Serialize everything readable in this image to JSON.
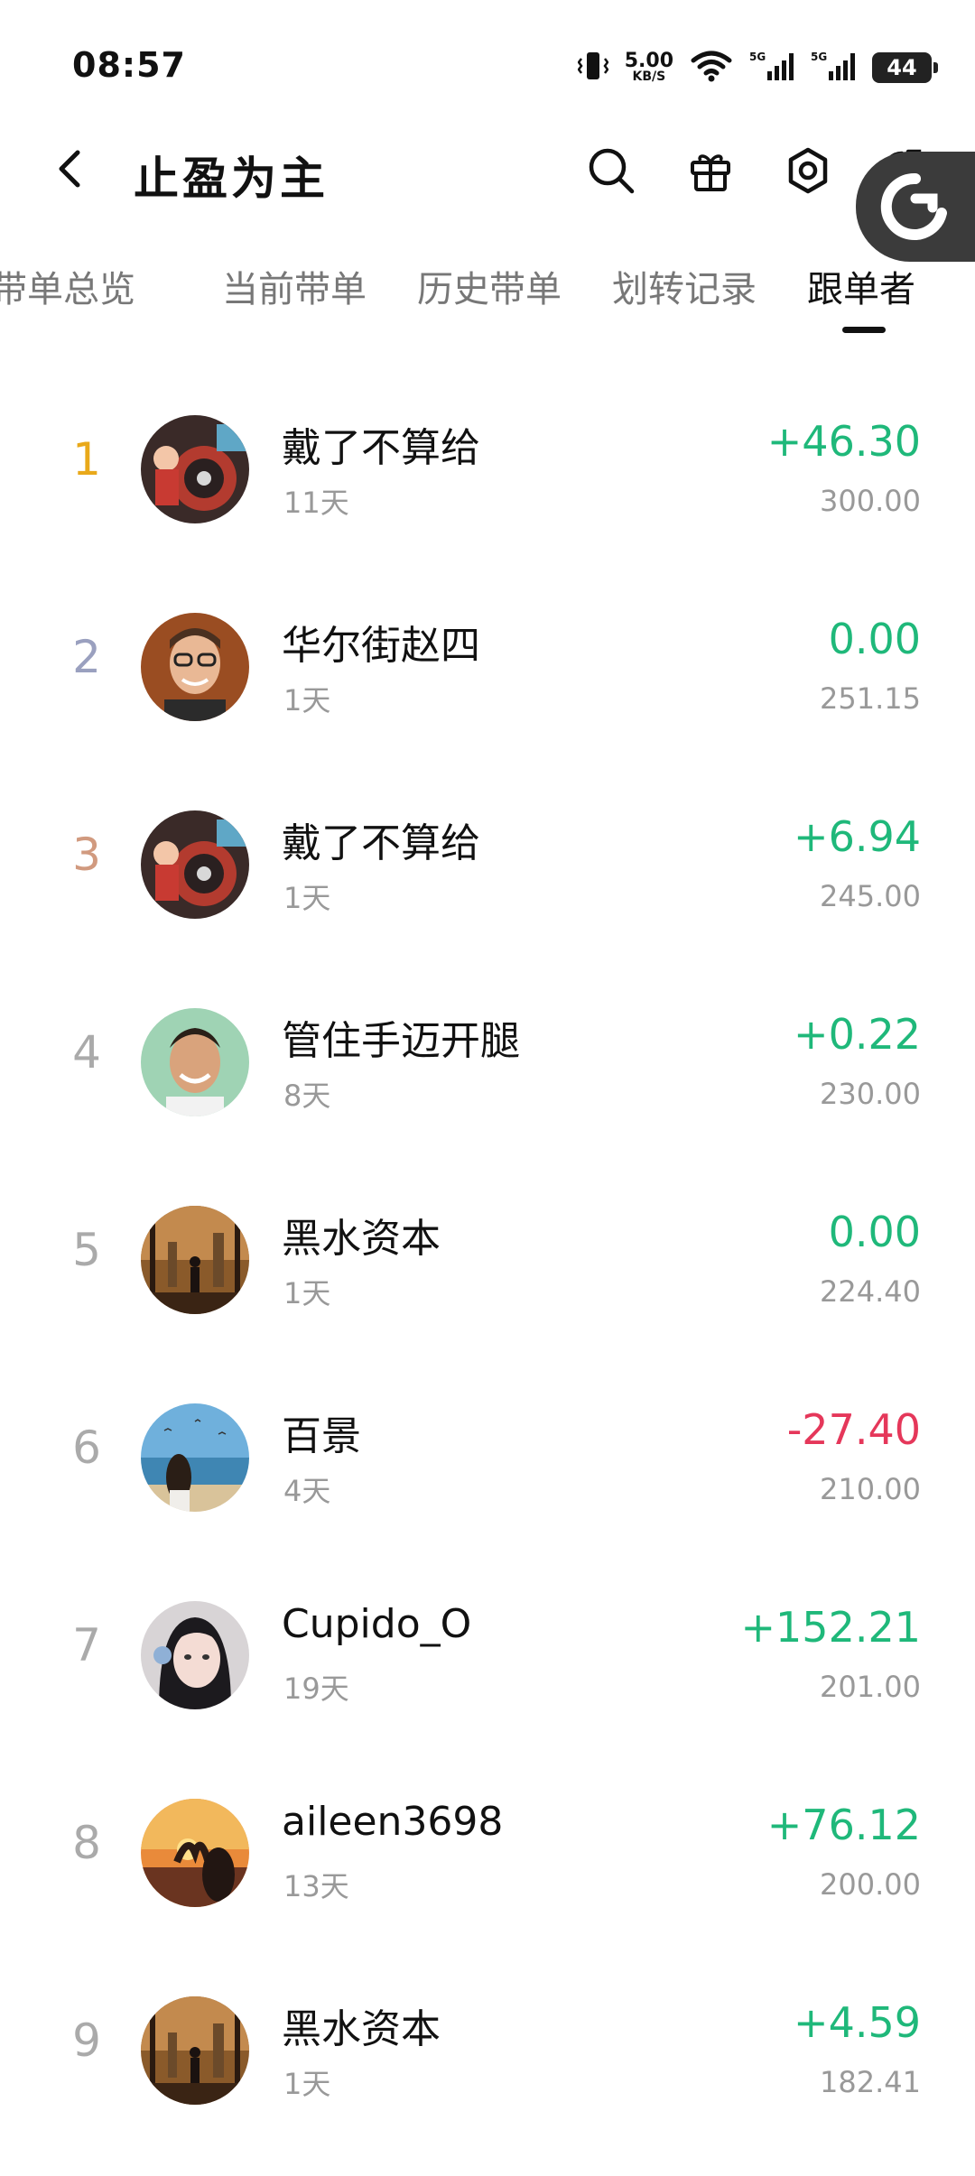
{
  "status": {
    "time": "08:57",
    "net_speed": "5.00",
    "net_unit": "KB/S",
    "signal1_label": "5G",
    "signal2_label": "5G",
    "battery": "44"
  },
  "header": {
    "title": "止盈为主"
  },
  "tabs": [
    {
      "label": "带单总览"
    },
    {
      "label": "当前带单"
    },
    {
      "label": "历史带单"
    },
    {
      "label": "划转记录"
    },
    {
      "label": "跟单者"
    }
  ],
  "followers": [
    {
      "rank": "1",
      "name": "戴了不算给",
      "days": "11天",
      "pnl": "+46.30",
      "amount": "300.00"
    },
    {
      "rank": "2",
      "name": "华尔街赵四",
      "days": "1天",
      "pnl": "0.00",
      "amount": "251.15"
    },
    {
      "rank": "3",
      "name": "戴了不算给",
      "days": "1天",
      "pnl": "+6.94",
      "amount": "245.00"
    },
    {
      "rank": "4",
      "name": "管住手迈开腿",
      "days": "8天",
      "pnl": "+0.22",
      "amount": "230.00"
    },
    {
      "rank": "5",
      "name": "黑水资本",
      "days": "1天",
      "pnl": "0.00",
      "amount": "224.40"
    },
    {
      "rank": "6",
      "name": "百景",
      "days": "4天",
      "pnl": "-27.40",
      "amount": "210.00"
    },
    {
      "rank": "7",
      "name": "Cupido_O",
      "days": "19天",
      "pnl": "+152.21",
      "amount": "201.00"
    },
    {
      "rank": "8",
      "name": "aileen3698",
      "days": "13天",
      "pnl": "+76.12",
      "amount": "200.00"
    },
    {
      "rank": "9",
      "name": "黑水资本",
      "days": "1天",
      "pnl": "+4.59",
      "amount": "182.41"
    }
  ],
  "colors": {
    "positive": "#1fb87a",
    "negative": "#e5375a",
    "rank_gold": "#e9a91a",
    "rank_silver": "#9aa0bf",
    "rank_bronze": "#d19a7f"
  }
}
